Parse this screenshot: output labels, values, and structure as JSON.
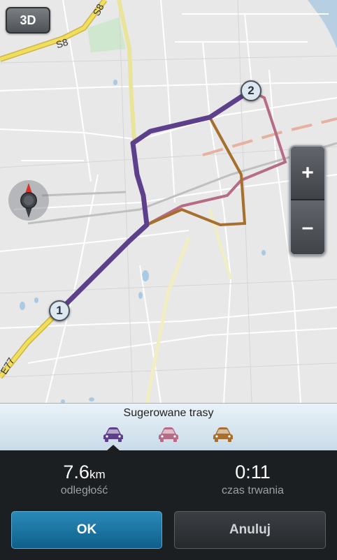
{
  "map": {
    "view_toggle_label": "3D",
    "road_labels": {
      "s8_top": "S8",
      "s8_left": "S8",
      "e77": "E77"
    },
    "waypoints": {
      "start": "1",
      "end": "2"
    },
    "zoom": {
      "in_label": "+",
      "out_label": "–"
    }
  },
  "routes_panel": {
    "title": "Sugerowane trasy",
    "routes": [
      {
        "icon": "car-icon",
        "color": "#5d3f8c",
        "selected": true
      },
      {
        "icon": "car-icon",
        "color": "#b66b86",
        "selected": false
      },
      {
        "icon": "car-icon",
        "color": "#a66f2d",
        "selected": false
      }
    ]
  },
  "summary": {
    "distance_value": "7.6",
    "distance_unit": "km",
    "distance_label": "odległość",
    "duration_value": "0:11",
    "duration_label": "czas trwania"
  },
  "actions": {
    "ok_label": "OK",
    "cancel_label": "Anuluj"
  }
}
